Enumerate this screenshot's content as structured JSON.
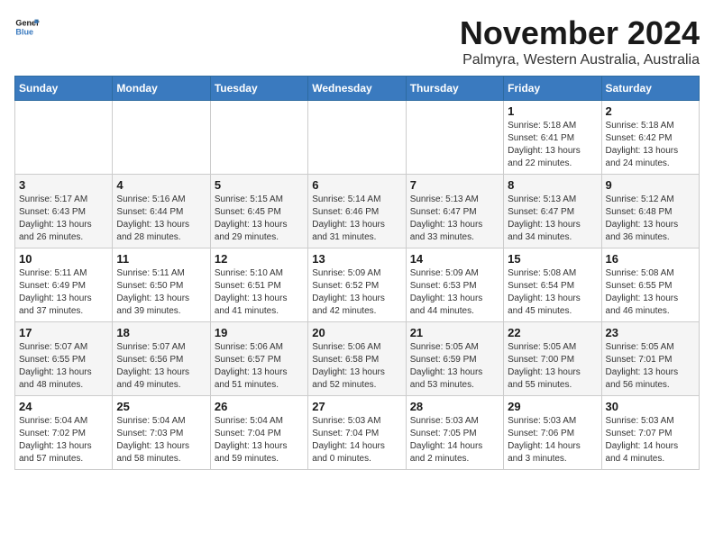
{
  "logo": {
    "line1": "General",
    "line2": "Blue"
  },
  "title": "November 2024",
  "location": "Palmyra, Western Australia, Australia",
  "days_of_week": [
    "Sunday",
    "Monday",
    "Tuesday",
    "Wednesday",
    "Thursday",
    "Friday",
    "Saturday"
  ],
  "weeks": [
    [
      {
        "day": "",
        "info": ""
      },
      {
        "day": "",
        "info": ""
      },
      {
        "day": "",
        "info": ""
      },
      {
        "day": "",
        "info": ""
      },
      {
        "day": "",
        "info": ""
      },
      {
        "day": "1",
        "info": "Sunrise: 5:18 AM\nSunset: 6:41 PM\nDaylight: 13 hours\nand 22 minutes."
      },
      {
        "day": "2",
        "info": "Sunrise: 5:18 AM\nSunset: 6:42 PM\nDaylight: 13 hours\nand 24 minutes."
      }
    ],
    [
      {
        "day": "3",
        "info": "Sunrise: 5:17 AM\nSunset: 6:43 PM\nDaylight: 13 hours\nand 26 minutes."
      },
      {
        "day": "4",
        "info": "Sunrise: 5:16 AM\nSunset: 6:44 PM\nDaylight: 13 hours\nand 28 minutes."
      },
      {
        "day": "5",
        "info": "Sunrise: 5:15 AM\nSunset: 6:45 PM\nDaylight: 13 hours\nand 29 minutes."
      },
      {
        "day": "6",
        "info": "Sunrise: 5:14 AM\nSunset: 6:46 PM\nDaylight: 13 hours\nand 31 minutes."
      },
      {
        "day": "7",
        "info": "Sunrise: 5:13 AM\nSunset: 6:47 PM\nDaylight: 13 hours\nand 33 minutes."
      },
      {
        "day": "8",
        "info": "Sunrise: 5:13 AM\nSunset: 6:47 PM\nDaylight: 13 hours\nand 34 minutes."
      },
      {
        "day": "9",
        "info": "Sunrise: 5:12 AM\nSunset: 6:48 PM\nDaylight: 13 hours\nand 36 minutes."
      }
    ],
    [
      {
        "day": "10",
        "info": "Sunrise: 5:11 AM\nSunset: 6:49 PM\nDaylight: 13 hours\nand 37 minutes."
      },
      {
        "day": "11",
        "info": "Sunrise: 5:11 AM\nSunset: 6:50 PM\nDaylight: 13 hours\nand 39 minutes."
      },
      {
        "day": "12",
        "info": "Sunrise: 5:10 AM\nSunset: 6:51 PM\nDaylight: 13 hours\nand 41 minutes."
      },
      {
        "day": "13",
        "info": "Sunrise: 5:09 AM\nSunset: 6:52 PM\nDaylight: 13 hours\nand 42 minutes."
      },
      {
        "day": "14",
        "info": "Sunrise: 5:09 AM\nSunset: 6:53 PM\nDaylight: 13 hours\nand 44 minutes."
      },
      {
        "day": "15",
        "info": "Sunrise: 5:08 AM\nSunset: 6:54 PM\nDaylight: 13 hours\nand 45 minutes."
      },
      {
        "day": "16",
        "info": "Sunrise: 5:08 AM\nSunset: 6:55 PM\nDaylight: 13 hours\nand 46 minutes."
      }
    ],
    [
      {
        "day": "17",
        "info": "Sunrise: 5:07 AM\nSunset: 6:55 PM\nDaylight: 13 hours\nand 48 minutes."
      },
      {
        "day": "18",
        "info": "Sunrise: 5:07 AM\nSunset: 6:56 PM\nDaylight: 13 hours\nand 49 minutes."
      },
      {
        "day": "19",
        "info": "Sunrise: 5:06 AM\nSunset: 6:57 PM\nDaylight: 13 hours\nand 51 minutes."
      },
      {
        "day": "20",
        "info": "Sunrise: 5:06 AM\nSunset: 6:58 PM\nDaylight: 13 hours\nand 52 minutes."
      },
      {
        "day": "21",
        "info": "Sunrise: 5:05 AM\nSunset: 6:59 PM\nDaylight: 13 hours\nand 53 minutes."
      },
      {
        "day": "22",
        "info": "Sunrise: 5:05 AM\nSunset: 7:00 PM\nDaylight: 13 hours\nand 55 minutes."
      },
      {
        "day": "23",
        "info": "Sunrise: 5:05 AM\nSunset: 7:01 PM\nDaylight: 13 hours\nand 56 minutes."
      }
    ],
    [
      {
        "day": "24",
        "info": "Sunrise: 5:04 AM\nSunset: 7:02 PM\nDaylight: 13 hours\nand 57 minutes."
      },
      {
        "day": "25",
        "info": "Sunrise: 5:04 AM\nSunset: 7:03 PM\nDaylight: 13 hours\nand 58 minutes."
      },
      {
        "day": "26",
        "info": "Sunrise: 5:04 AM\nSunset: 7:04 PM\nDaylight: 13 hours\nand 59 minutes."
      },
      {
        "day": "27",
        "info": "Sunrise: 5:03 AM\nSunset: 7:04 PM\nDaylight: 14 hours\nand 0 minutes."
      },
      {
        "day": "28",
        "info": "Sunrise: 5:03 AM\nSunset: 7:05 PM\nDaylight: 14 hours\nand 2 minutes."
      },
      {
        "day": "29",
        "info": "Sunrise: 5:03 AM\nSunset: 7:06 PM\nDaylight: 14 hours\nand 3 minutes."
      },
      {
        "day": "30",
        "info": "Sunrise: 5:03 AM\nSunset: 7:07 PM\nDaylight: 14 hours\nand 4 minutes."
      }
    ]
  ]
}
